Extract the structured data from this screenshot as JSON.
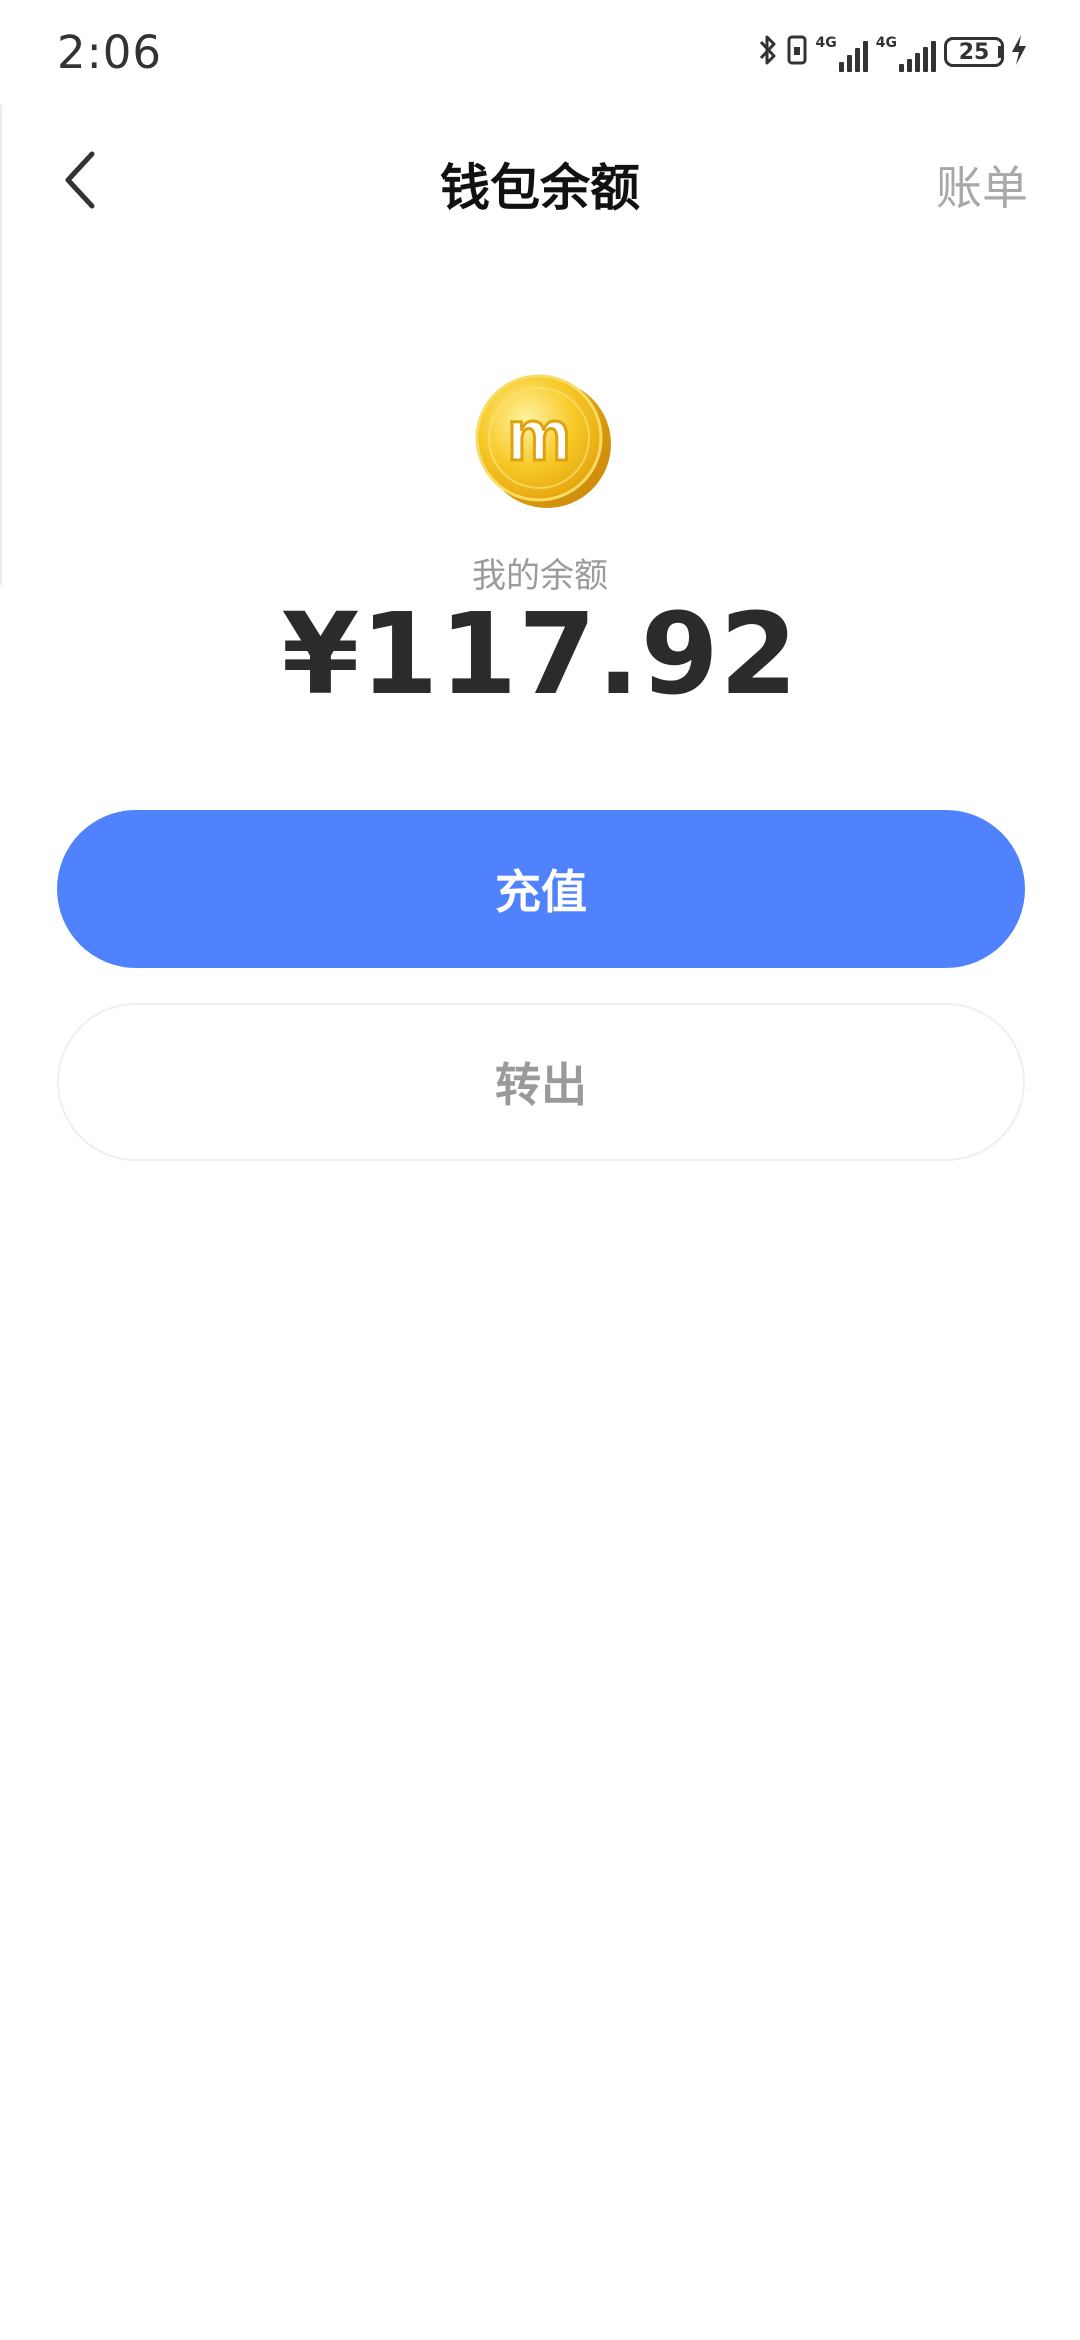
{
  "status_bar": {
    "time": "2:06",
    "network_1": "4G",
    "network_2": "4G",
    "battery_level": "25",
    "icons": [
      "bluetooth-icon",
      "vibrate-icon",
      "signal-icon",
      "signal-icon",
      "battery-icon",
      "charging-icon"
    ]
  },
  "nav": {
    "back_icon": "chevron-left-icon",
    "title": "钱包余额",
    "action_label": "账单"
  },
  "balance": {
    "coin_icon": "coin-icon",
    "coin_letter": "m",
    "label": "我的余额",
    "amount": "¥117.92"
  },
  "actions": {
    "recharge_label": "充值",
    "transfer_out_label": "转出"
  },
  "colors": {
    "primary": "#5182fd",
    "title_text": "#111111",
    "muted_text": "#9b9b9b",
    "amount_text": "#2b2b2b",
    "coin_gold": "#f5c518"
  }
}
